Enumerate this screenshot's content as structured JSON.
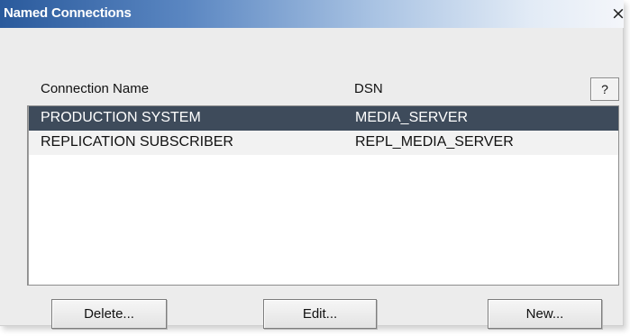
{
  "window": {
    "title": "Named Connections",
    "close_glyph": "×"
  },
  "columns": {
    "name_header": "Connection Name",
    "dsn_header": "DSN",
    "help_label": "?"
  },
  "connections": [
    {
      "name": "PRODUCTION SYSTEM",
      "dsn": "MEDIA_SERVER",
      "selected": true
    },
    {
      "name": "REPLICATION SUBSCRIBER",
      "dsn": "REPL_MEDIA_SERVER",
      "selected": false
    }
  ],
  "buttons": {
    "delete": "Delete...",
    "edit": "Edit...",
    "new": "New..."
  },
  "colors": {
    "title_gradient_start": "#2a5a9c",
    "selected_row": "#3e4b5b",
    "dialog_bg": "#ececec"
  }
}
